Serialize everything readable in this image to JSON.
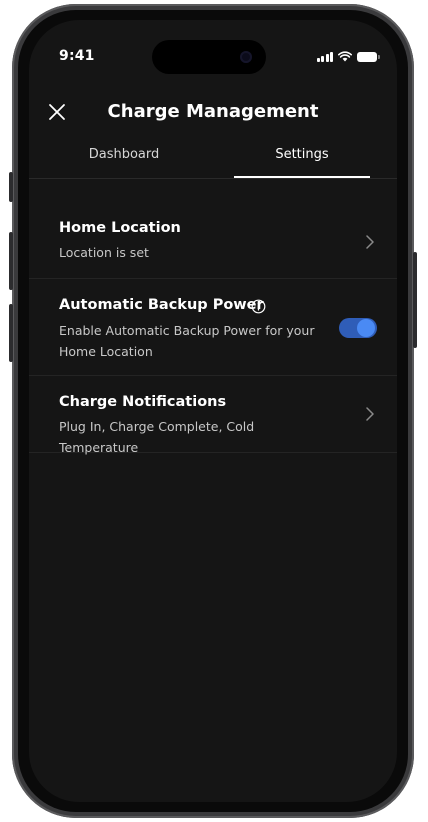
{
  "status_bar": {
    "time": "9:41",
    "icons": [
      "signal-icon",
      "wifi-icon",
      "battery-icon"
    ]
  },
  "header": {
    "title": "Charge Management",
    "close_icon": "close-icon"
  },
  "tabs": [
    {
      "label": "Dashboard",
      "active": false
    },
    {
      "label": "Settings",
      "active": true
    }
  ],
  "settings": {
    "home_location": {
      "title": "Home Location",
      "subtitle": "Location is set",
      "icon": "chevron-right-icon"
    },
    "backup_power": {
      "title": "Automatic Backup Power",
      "subtitle": "Enable Automatic Backup Power for your Home Location",
      "info_icon": "info-icon",
      "toggle_on": true
    },
    "charge_notifications": {
      "title": "Charge Notifications",
      "subtitle": "Plug In, Charge Complete, Cold Temperature",
      "icon": "chevron-right-icon"
    }
  },
  "colors": {
    "background": "#151515",
    "accent": "#4a8af4",
    "toggle_track": "#2f5db8",
    "text_primary": "#ffffff",
    "text_secondary": "#c8c8c8"
  }
}
